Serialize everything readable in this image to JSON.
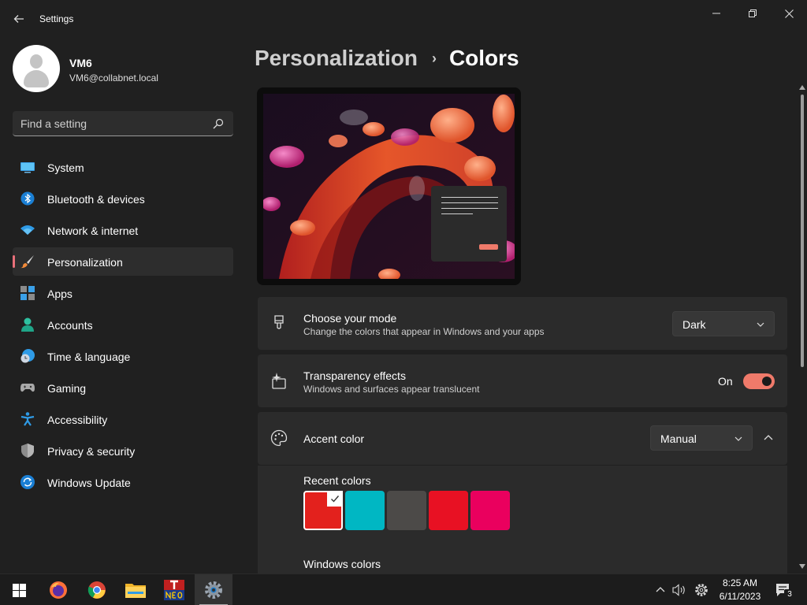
{
  "window": {
    "title": "Settings",
    "back_icon": "back-arrow-icon",
    "controls": [
      "minimize-icon",
      "maximize-icon",
      "close-icon"
    ]
  },
  "profile": {
    "name": "VM6",
    "email": "VM6@collabnet.local"
  },
  "search": {
    "placeholder": "Find a setting",
    "value": ""
  },
  "sidebar": {
    "items": [
      {
        "label": "System",
        "icon": "system-monitor-icon",
        "active": false
      },
      {
        "label": "Bluetooth & devices",
        "icon": "bluetooth-icon",
        "active": false
      },
      {
        "label": "Network & internet",
        "icon": "wifi-icon",
        "active": false
      },
      {
        "label": "Personalization",
        "icon": "paintbrush-icon",
        "active": true
      },
      {
        "label": "Apps",
        "icon": "apps-icon",
        "active": false
      },
      {
        "label": "Accounts",
        "icon": "person-icon",
        "active": false
      },
      {
        "label": "Time & language",
        "icon": "clock-globe-icon",
        "active": false
      },
      {
        "label": "Gaming",
        "icon": "gamepad-icon",
        "active": false
      },
      {
        "label": "Accessibility",
        "icon": "accessibility-icon",
        "active": false
      },
      {
        "label": "Privacy & security",
        "icon": "shield-icon",
        "active": false
      },
      {
        "label": "Windows Update",
        "icon": "update-icon",
        "active": false
      }
    ]
  },
  "breadcrumb": {
    "parent": "Personalization",
    "separator": "›",
    "current": "Colors"
  },
  "settings": {
    "mode": {
      "title": "Choose your mode",
      "description": "Change the colors that appear in Windows and your apps",
      "value": "Dark",
      "icon": "paint-bucket-icon"
    },
    "transparency": {
      "title": "Transparency effects",
      "description": "Windows and surfaces appear translucent",
      "state_label": "On",
      "enabled": true,
      "icon": "sparkle-icon"
    },
    "accent": {
      "title": "Accent color",
      "value": "Manual",
      "expanded": true,
      "icon": "palette-icon"
    },
    "recent_colors_label": "Recent colors",
    "recent_colors": [
      "#e3211d",
      "#00b7c3",
      "#4c4a48",
      "#e81123",
      "#ea005e"
    ],
    "selected_color_index": 0,
    "windows_colors_label": "Windows colors"
  },
  "colors": {
    "accent": "#ef7a6a",
    "background": "#202020",
    "card": "#2b2b2b",
    "active_indicator": "#e8707a"
  },
  "taskbar": {
    "apps": [
      {
        "name": "start",
        "icon": "windows-start-icon",
        "active": false
      },
      {
        "name": "firefox",
        "icon": "firefox-icon",
        "active": false
      },
      {
        "name": "chrome",
        "icon": "chrome-icon",
        "active": false
      },
      {
        "name": "file-explorer",
        "icon": "folder-icon",
        "active": false
      },
      {
        "name": "neo",
        "icon": "neo-app-icon",
        "active": false
      },
      {
        "name": "settings",
        "icon": "settings-gear-icon",
        "active": true
      }
    ],
    "clock": {
      "time": "8:25 AM",
      "date": "6/11/2023"
    },
    "notification_count": "3"
  }
}
